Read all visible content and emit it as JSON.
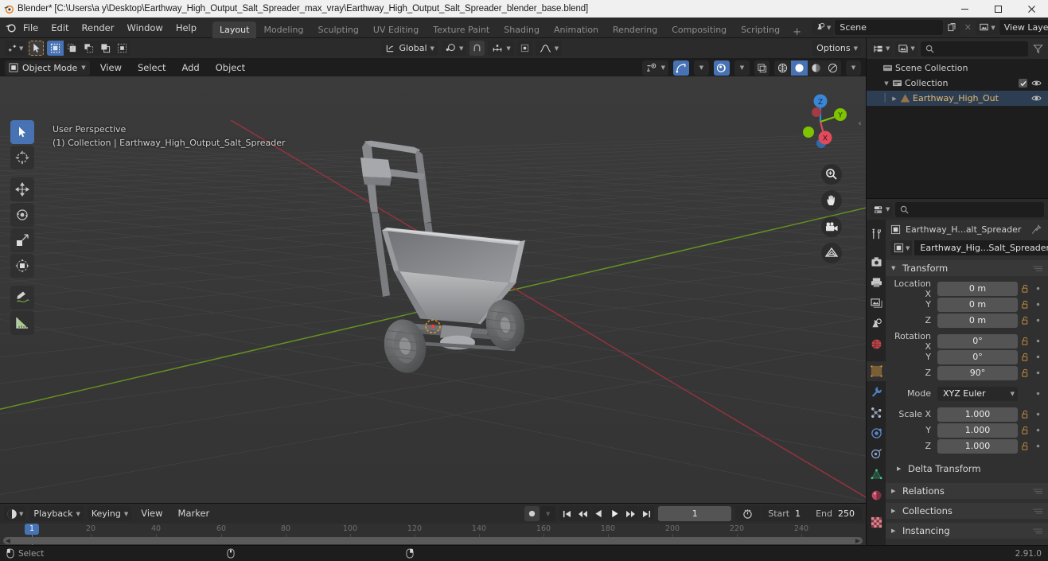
{
  "window": {
    "title": "Blender* [C:\\Users\\a y\\Desktop\\Earthway_High_Output_Salt_Spreader_max_vray\\Earthway_High_Output_Salt_Spreader_blender_base.blend]",
    "minimize": "─",
    "maximize": "☐",
    "close": "✕"
  },
  "topbar": {
    "menus": [
      "File",
      "Edit",
      "Render",
      "Window",
      "Help"
    ],
    "workspaces": [
      {
        "label": "Layout",
        "active": true
      },
      {
        "label": "Modeling",
        "active": false
      },
      {
        "label": "Sculpting",
        "active": false
      },
      {
        "label": "UV Editing",
        "active": false
      },
      {
        "label": "Texture Paint",
        "active": false
      },
      {
        "label": "Shading",
        "active": false
      },
      {
        "label": "Animation",
        "active": false
      },
      {
        "label": "Rendering",
        "active": false
      },
      {
        "label": "Compositing",
        "active": false
      },
      {
        "label": "Scripting",
        "active": false
      }
    ],
    "add_workspace": "+",
    "scene_name": "Scene",
    "view_layer_name": "View Layer"
  },
  "viewport": {
    "header": {
      "transform_orientation": "Global",
      "snap_label": "",
      "options_label": "Options"
    },
    "header2": {
      "mode": "Object Mode",
      "menus": [
        "View",
        "Select",
        "Add",
        "Object"
      ]
    },
    "overlay": {
      "line1": "User Perspective",
      "line2": "(1) Collection | Earthway_High_Output_Salt_Spreader"
    },
    "gizmo": {
      "axis_z": "Z",
      "axis_y": "Y",
      "axis_x": "X"
    },
    "nav_icons": [
      "zoom-icon",
      "pan-icon",
      "camera-icon",
      "ortho-grid-icon"
    ],
    "left_tools": [
      {
        "name": "tweak-select-tool",
        "active": true
      },
      {
        "name": "cursor-tool",
        "active": false
      },
      {
        "name": "move-tool",
        "active": false
      },
      {
        "name": "rotate-tool",
        "active": false
      },
      {
        "name": "scale-tool",
        "active": false
      },
      {
        "name": "transform-tool",
        "active": false
      },
      {
        "name": "annotate-tool",
        "active": false
      },
      {
        "name": "measure-tool",
        "active": false
      }
    ]
  },
  "timeline": {
    "editor_label": "",
    "menus": [
      "Playback",
      "Keying",
      "View",
      "Marker"
    ],
    "current_frame": "1",
    "start_label": "Start",
    "start_value": "1",
    "end_label": "End",
    "end_value": "250",
    "ticks": [
      {
        "label": "20",
        "frame": 20
      },
      {
        "label": "40",
        "frame": 40
      },
      {
        "label": "60",
        "frame": 60
      },
      {
        "label": "80",
        "frame": 80
      },
      {
        "label": "100",
        "frame": 100
      },
      {
        "label": "120",
        "frame": 120
      },
      {
        "label": "140",
        "frame": 140
      },
      {
        "label": "160",
        "frame": 160
      },
      {
        "label": "180",
        "frame": 180
      },
      {
        "label": "200",
        "frame": 200
      },
      {
        "label": "220",
        "frame": 220
      },
      {
        "label": "240",
        "frame": 240
      }
    ],
    "playhead_frame": 1,
    "playhead_label": "1"
  },
  "outliner": {
    "search_placeholder": "",
    "rows": [
      {
        "name": "Scene Collection",
        "indent": 0,
        "type": "scene-collection",
        "disclosure": "",
        "checkbox": false,
        "eye": false,
        "selected": false
      },
      {
        "name": "Collection",
        "indent": 1,
        "type": "collection",
        "disclosure": "▼",
        "checkbox": true,
        "eye": true,
        "selected": false
      },
      {
        "name": "Earthway_High_Outp",
        "indent": 2,
        "type": "mesh-object",
        "disclosure": "▶",
        "checkbox": false,
        "eye": true,
        "selected": true
      }
    ]
  },
  "properties": {
    "search_placeholder": "",
    "tabs": [
      {
        "name": "tool-tab",
        "active": false
      },
      {
        "name": "render-tab",
        "active": false
      },
      {
        "name": "output-tab",
        "active": false
      },
      {
        "name": "view-layer-tab",
        "active": false
      },
      {
        "name": "scene-tab",
        "active": false
      },
      {
        "name": "world-tab",
        "active": false
      },
      {
        "name": "object-tab",
        "active": true
      },
      {
        "name": "modifier-tab",
        "active": false
      },
      {
        "name": "particles-tab",
        "active": false
      },
      {
        "name": "physics-tab",
        "active": false
      },
      {
        "name": "constraints-tab",
        "active": false
      },
      {
        "name": "object-data-tab",
        "active": false
      },
      {
        "name": "material-tab",
        "active": false
      },
      {
        "name": "texture-tab",
        "active": false
      }
    ],
    "breadcrumb_object": "Earthway_H...alt_Spreader",
    "id_name": "Earthway_Hig...Salt_Spreader",
    "transform": {
      "title": "Transform",
      "location": {
        "label_x": "Location X",
        "label_y": "Y",
        "label_z": "Z",
        "x": "0 m",
        "y": "0 m",
        "z": "0 m"
      },
      "rotation": {
        "label_x": "Rotation X",
        "label_y": "Y",
        "label_z": "Z",
        "x": "0°",
        "y": "0°",
        "z": "90°"
      },
      "mode": {
        "label": "Mode",
        "value": "XYZ Euler"
      },
      "scale": {
        "label_x": "Scale X",
        "label_y": "Y",
        "label_z": "Z",
        "x": "1.000",
        "y": "1.000",
        "z": "1.000"
      },
      "delta_transform": "Delta Transform"
    },
    "panels": [
      "Relations",
      "Collections",
      "Instancing"
    ]
  },
  "statusbar": {
    "select_label": "Select",
    "version": "2.91.0"
  },
  "colors": {
    "accent_blue": "#4772b3",
    "active_orange": "#e8a33d",
    "axis_x_red": "#e04a5a",
    "axis_y_green": "#7ec400",
    "axis_z_blue": "#3a87d8",
    "header_bg": "#2b2b2b",
    "panel_bg": "#303030",
    "field_bg": "#545454"
  }
}
